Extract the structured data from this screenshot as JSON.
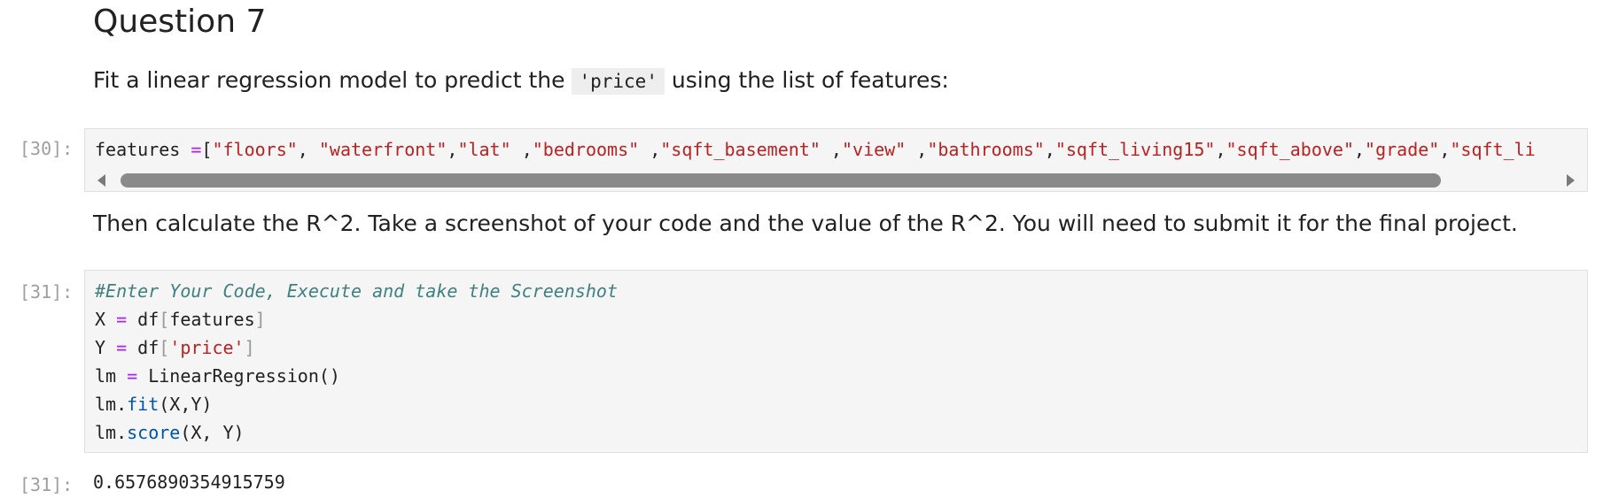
{
  "heading": "Question 7",
  "intro": {
    "before": "Fit a linear regression model to predict the ",
    "code": "'price'",
    "after": " using the list of features:"
  },
  "cell30": {
    "prompt": "[30]:",
    "lhs": "features ",
    "op": "=",
    "bracket": "[",
    "items": [
      "\"floors\"",
      ", ",
      "\"waterfront\"",
      ",",
      "\"lat\"",
      " ,",
      "\"bedrooms\"",
      " ,",
      "\"sqft_basement\"",
      " ,",
      "\"view\"",
      " ,",
      "\"bathrooms\"",
      ",",
      "\"sqft_living15\"",
      ",",
      "\"sqft_above\"",
      ",",
      "\"grade\"",
      ",",
      "\"sqft_li"
    ]
  },
  "instruction": "Then calculate the R^2. Take a screenshot of your code and the value of the R^2. You will need to submit it for the final project.",
  "cell31": {
    "prompt": "[31]:",
    "comment": "#Enter Your Code, Execute and take the Screenshot",
    "line2": {
      "a": "X ",
      "op": "=",
      "b": " df",
      "open": "[",
      "arg": "features",
      "close": "]"
    },
    "line3": {
      "a": "Y ",
      "op": "=",
      "b": " df",
      "open": "[",
      "arg": "'price'",
      "close": "]"
    },
    "line4": {
      "a": "lm ",
      "op": "=",
      "b": " LinearRegression()"
    },
    "line5": {
      "a": "lm.",
      "fn": "fit",
      "b": "(X,Y)"
    },
    "line6": {
      "a": "lm.",
      "fn": "score",
      "b": "(X, Y)"
    }
  },
  "output31": {
    "prompt": "[31]:",
    "value": "0.6576890354915759"
  }
}
